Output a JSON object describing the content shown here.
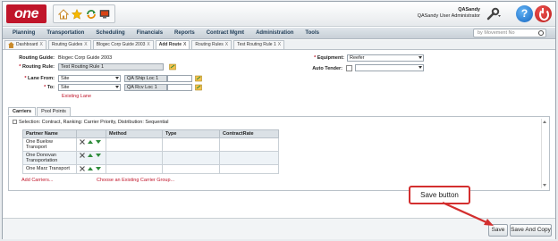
{
  "header": {
    "logo_text": "one",
    "user_name": "QASandy",
    "user_role": "QASandy User Administrator",
    "help_label": "?",
    "icons": [
      "home-icon",
      "star-icon",
      "refresh-icon",
      "screen-icon",
      "wrench-icon",
      "help-icon",
      "power-icon"
    ]
  },
  "nav": {
    "items": [
      "Planning",
      "Transportation",
      "Scheduling",
      "Financials",
      "Reports",
      "Contract Mgmt",
      "Administration",
      "Tools"
    ],
    "search_placeholder": "by Movement No"
  },
  "tabs": [
    {
      "label": "Dashboard",
      "active": false
    },
    {
      "label": "Routing Guides",
      "active": false
    },
    {
      "label": "Blogec Corp Guide 2003",
      "active": false
    },
    {
      "label": "Add Route",
      "active": true
    },
    {
      "label": "Routing Rules",
      "active": false
    },
    {
      "label": "Test Routing Rule 1",
      "active": false
    }
  ],
  "tab_close": "X",
  "form": {
    "routing_guide_label": "Routing Guide:",
    "routing_guide_value": "Blogec Corp Guide 2003",
    "routing_rule_label": "Routing Rule:",
    "routing_rule_value": "Test Routing Rule 1",
    "lane_from_label": "Lane From:",
    "lane_from_value": "Site",
    "lane_from_loc": "QA Ship Loc 1",
    "to_label": "To:",
    "to_value": "Site",
    "to_loc": "QA Rcv Loc 1",
    "existing_lane": "Existing Lane",
    "equipment_label": "Equipment:",
    "equipment_value": "Reefer",
    "auto_tender_label": "Auto Tender:",
    "auto_tender_value": "",
    "required_mark": "*"
  },
  "subtabs": [
    {
      "label": "Carriers",
      "active": true
    },
    {
      "label": "Pool Points",
      "active": false
    }
  ],
  "carriers": {
    "selection_text": "Selection: Contract, Ranking: Carrier Priority, Distribution: Sequential",
    "columns": [
      "Partner Name",
      "",
      "Method",
      "Type",
      "ContractRate"
    ],
    "rows": [
      {
        "partner": "One Buelow Transport",
        "method": "",
        "type": "",
        "rate": ""
      },
      {
        "partner": "One Donovan Transportation",
        "method": "",
        "type": "",
        "rate": ""
      },
      {
        "partner": "One Marz Transport",
        "method": "",
        "type": "",
        "rate": ""
      }
    ],
    "add_link": "Add Carriers...",
    "group_link": "Choose an Existing Carrier Group..."
  },
  "footer": {
    "save_label": "Save",
    "save_copy_label": "Save And Copy"
  },
  "callout": {
    "text": "Save button",
    "color": "#d32f2f"
  },
  "colors": {
    "brand": "#c0152a",
    "nav_text": "#1f3c57",
    "accent_green": "#2e8b3a"
  }
}
